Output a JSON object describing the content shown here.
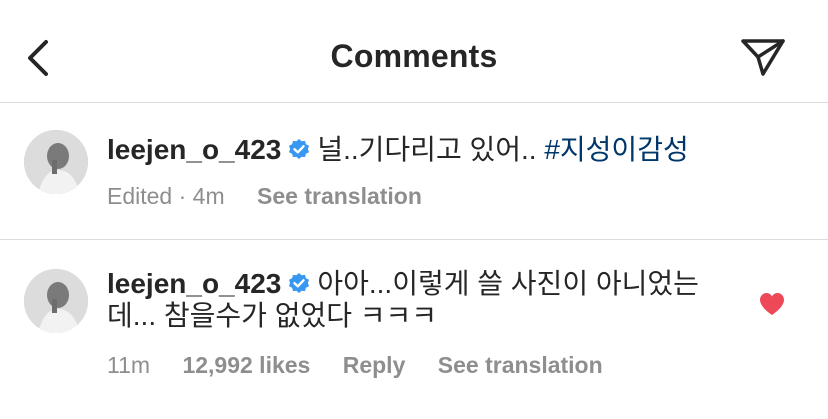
{
  "header": {
    "title": "Comments",
    "back_icon": "chevron-left-icon",
    "send_icon": "paper-plane-icon"
  },
  "caption": {
    "username": "leejen_o_423",
    "verified": true,
    "text": "널..기다리고 있어.. ",
    "hashtag": "#지성이감성",
    "edited": "Edited",
    "separator": "·",
    "time": "4m",
    "translate": "See translation"
  },
  "comment": {
    "username": "leejen_o_423",
    "verified": true,
    "text_line1": "아아...이렇게 쓸 사진이 아니었는",
    "text_line2": "데... 참을수가 없었다 ㅋㅋㅋ",
    "time": "11m",
    "likes": "12,992 likes",
    "reply": "Reply",
    "translate": "See translation",
    "liked": true
  },
  "colors": {
    "text": "#262626",
    "secondary": "#8e8e8e",
    "hashtag": "#00376b",
    "verified": "#3897f0",
    "heart": "#ed4956",
    "divider": "#dbdbdb"
  }
}
